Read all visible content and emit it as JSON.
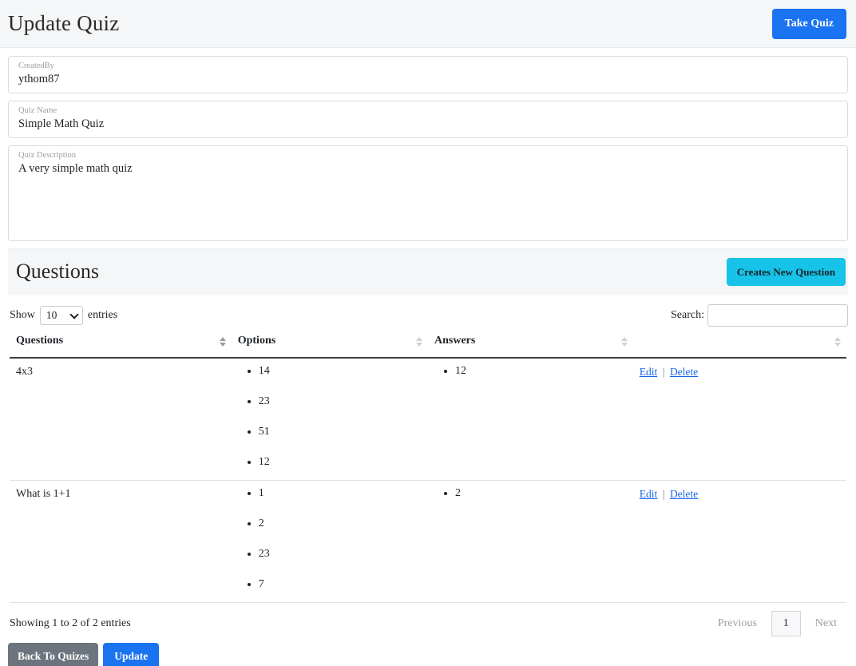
{
  "header": {
    "title": "Update Quiz",
    "take_quiz_label": "Take Quiz"
  },
  "form": {
    "created_by": {
      "label": "CreatedBy",
      "value": "ythom87"
    },
    "quiz_name": {
      "label": "Quiz Name",
      "value": "Simple Math Quiz"
    },
    "quiz_description": {
      "label": "Quiz Description",
      "value": "A very simple math quiz"
    }
  },
  "questions_section": {
    "title": "Questions",
    "new_question_label": "Creates New Question"
  },
  "datatable": {
    "show_label": "Show",
    "entries_label": "entries",
    "page_length": "10",
    "search_label": "Search:",
    "search_value": "",
    "search_placeholder": "",
    "columns": [
      {
        "label": "Questions",
        "sorted": true
      },
      {
        "label": "Options",
        "sorted": false
      },
      {
        "label": "Answers",
        "sorted": false
      },
      {
        "label": "",
        "sorted": false
      }
    ],
    "rows": [
      {
        "question": "4x3",
        "options": [
          "14",
          "23",
          "51",
          "12"
        ],
        "answers": [
          "12"
        ],
        "edit_label": "Edit",
        "separator": "|",
        "delete_label": "Delete"
      },
      {
        "question": "What is 1+1",
        "options": [
          "1",
          "2",
          "23",
          "7"
        ],
        "answers": [
          "2"
        ],
        "edit_label": "Edit",
        "separator": "|",
        "delete_label": "Delete"
      }
    ],
    "info": "Showing 1 to 2 of 2 entries",
    "previous_label": "Previous",
    "current_page": "1",
    "next_label": "Next"
  },
  "footer": {
    "back_label": "Back To Quizes",
    "update_label": "Update"
  },
  "colors": {
    "primary_blue": "#1a73f0",
    "cyan": "#17c3e8",
    "gray": "#6c757d",
    "link_blue": "#1a66e8",
    "header_bg": "#f5f6f7"
  }
}
